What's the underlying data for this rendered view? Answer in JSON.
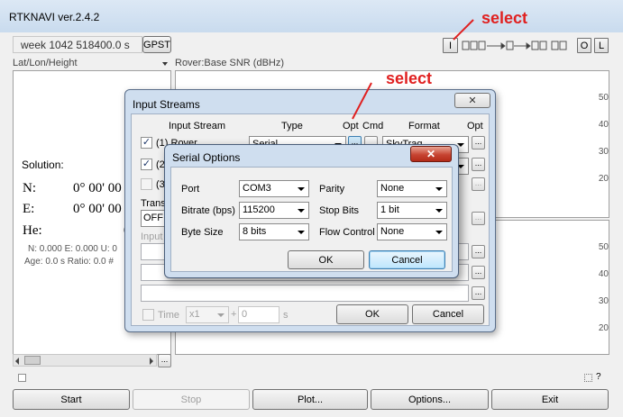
{
  "app": {
    "title": "RTKNAVI ver.2.4.2",
    "time_display": "week 1042 518400.0 s",
    "gpst_button": "GPST",
    "i_button": "I",
    "o_button": "O",
    "l_button": "L",
    "left_plot_select": "Lat/Lon/Height",
    "right_plot_select": "Rover:Base SNR (dBHz)",
    "solution_label": "Solution:",
    "n_label": "N:",
    "n_value": "0° 00' 00",
    "e_label": "E:",
    "e_value": "0° 00' 00",
    "he_label": "He:",
    "he_value": "0.",
    "stats_line1": "N: 0.000 E: 0.000 U: 0",
    "stats_line2": "Age: 0.0 s Ratio: 0.0 #",
    "snr_ticks_top": [
      "50",
      "40",
      "30",
      "20"
    ],
    "snr_ticks_bottom": [
      "50",
      "40",
      "30",
      "20"
    ],
    "buttons": {
      "start": "Start",
      "stop": "Stop",
      "plot": "Plot...",
      "options": "Options...",
      "exit": "Exit"
    },
    "ellipsis": "..."
  },
  "input_streams": {
    "title": "Input Streams",
    "headers": {
      "input_stream": "Input Stream",
      "type": "Type",
      "opt": "Opt",
      "cmd": "Cmd",
      "format": "Format",
      "opt2": "Opt"
    },
    "rows": [
      {
        "checked": true,
        "label": "(1) Rover",
        "type": "Serial",
        "format": "SkyTraq"
      },
      {
        "checked": true,
        "label": "(2)",
        "type": "Serial",
        "format": ""
      },
      {
        "checked": false,
        "label": "(3)",
        "type": "",
        "format": ""
      }
    ],
    "trans_label": "Trans",
    "trans_value": "OFF",
    "input_label": "Input",
    "time_label": "Time",
    "time_scale": "x1",
    "plus": "+",
    "time_offset": "0",
    "time_unit": "s",
    "ok": "OK",
    "cancel": "Cancel",
    "ellipsis": "..."
  },
  "serial_options": {
    "title": "Serial Options",
    "port_label": "Port",
    "port_value": "COM3",
    "bitrate_label": "Bitrate (bps)",
    "bitrate_value": "115200",
    "bytesize_label": "Byte Size",
    "bytesize_value": "8 bits",
    "parity_label": "Parity",
    "parity_value": "None",
    "stopbits_label": "Stop Bits",
    "stopbits_value": "1 bit",
    "flow_label": "Flow Control",
    "flow_value": "None",
    "ok": "OK",
    "cancel": "Cancel"
  },
  "annotations": {
    "select_top": "select",
    "select_mid": "select"
  }
}
